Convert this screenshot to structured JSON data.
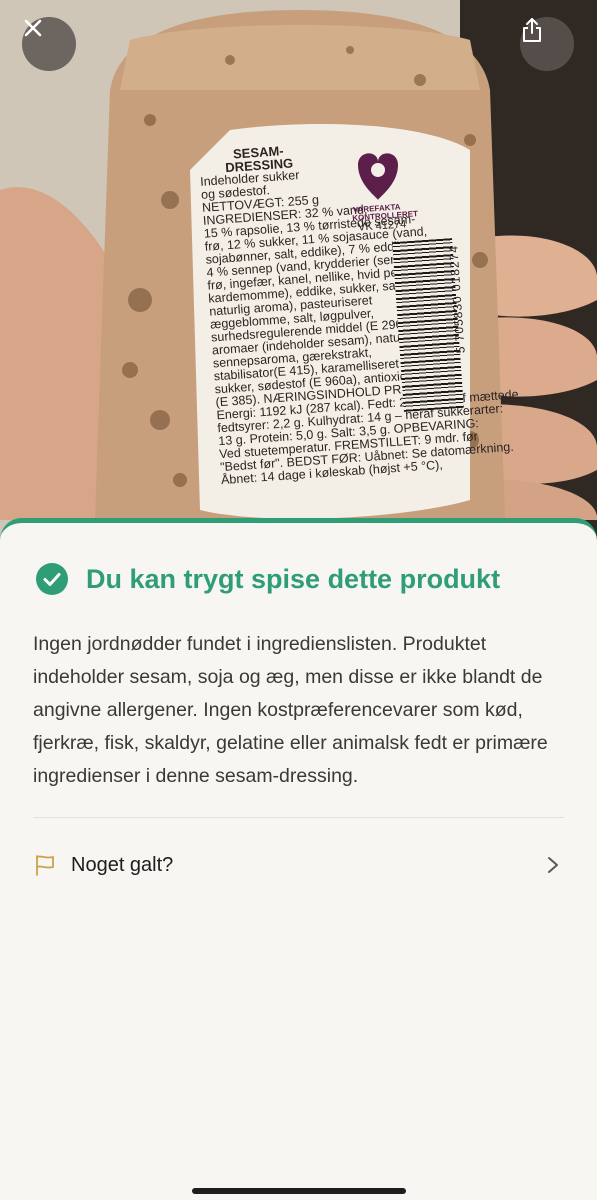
{
  "photo": {
    "label_title": [
      "SESAM-",
      "DRESSING"
    ],
    "label_lines": [
      "Indeholder sukker",
      "og sødestof.",
      "NETTOVÆGT: 255 g",
      "INGREDIENSER: 32 % vand,",
      "15 % rapsolie, 13 % tørristede sesam-",
      "frø, 12 % sukker, 11 % sojasauce (vand,",
      "sojabønner, salt, eddike), 7 % eddike,",
      "4 % sennep (vand, krydderier (senneps-",
      "frø, ingefær, kanel, nellike, hvid peber,",
      "kardemomme), eddike, sukker, salt,",
      "naturlig aroma), pasteuriseret",
      "æggeblomme, salt, løgpulver,",
      "surhedsregulerende middel (E 296),",
      "aromaer (indeholder sesam), naturlig",
      "sennepsaroma, gærekstrakt,",
      "stabilisator(E 415), karamelliseret",
      "sukker, sødestof (E 960a), antioxidant",
      "(E 385). NÆRINGSINDHOLD PR. 100 g:",
      "Energi: 1192 kJ (287 kcal). Fedt: 23 g – heraf mættede",
      "fedtsyrer: 2,2 g. Kulhydrat: 14 g – heraf sukkerarter:",
      "13 g. Protein: 5,0 g. Salt: 3,5 g. OPBEVARING:",
      "Ved stuetemperatur. FREMSTILLET: 9 mdr. før",
      "\"Bedst før\". BEDST FØR: Uåbnet: Se datomærkning.",
      "Åbnet: 14 dage i køleskab (højst +5 °C),"
    ],
    "varefakta": [
      "VAREFAKTA",
      "KONTROLLERET"
    ],
    "vk_number": "VK 41274",
    "barcode_digits": "5 705830 018274"
  },
  "buttons": {
    "close_icon": "close-icon",
    "share_icon": "share-icon"
  },
  "result": {
    "title": "Du kan trygt spise dette produkt",
    "description": "Ingen jordnødder fundet i ingredienslisten. Produktet indeholder sesam, soja og æg, men disse er ikke blandt de angivne allergener. Ingen kostpræferencevarer som kød, fjerkræ, fisk, skaldyr, gelatine eller animalsk fedt er primære ingredienser i denne sesam-dressing.",
    "report_label": "Noget galt?"
  },
  "colors": {
    "accent": "#2f9e77",
    "flag": "#c9a24b",
    "sheet_bg": "#f7f6f2"
  }
}
